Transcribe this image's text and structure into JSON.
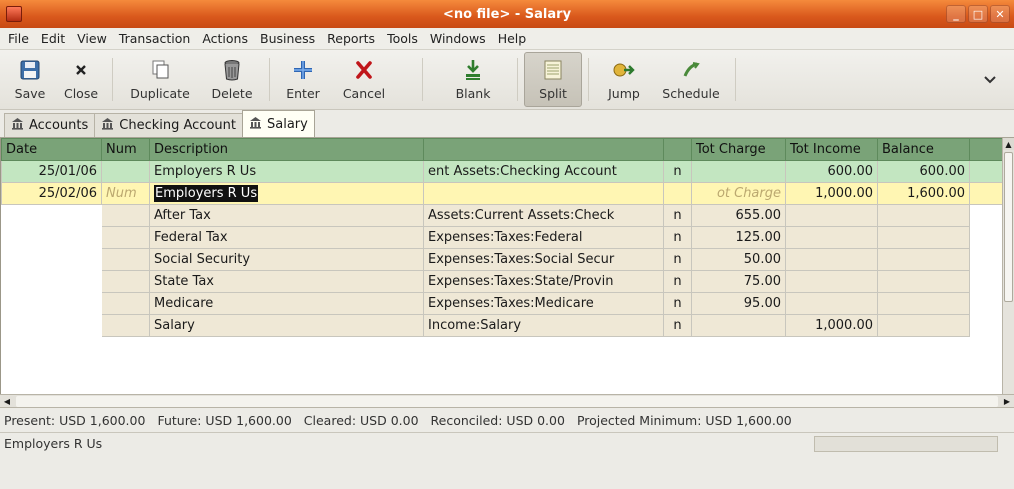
{
  "window": {
    "title": "<no file> - Salary"
  },
  "menu": [
    "File",
    "Edit",
    "View",
    "Transaction",
    "Actions",
    "Business",
    "Reports",
    "Tools",
    "Windows",
    "Help"
  ],
  "toolbar": {
    "save": "Save",
    "close": "Close",
    "duplicate": "Duplicate",
    "delete": "Delete",
    "enter": "Enter",
    "cancel": "Cancel",
    "blank": "Blank",
    "split": "Split",
    "jump": "Jump",
    "schedule": "Schedule"
  },
  "tabs": [
    {
      "label": "Accounts"
    },
    {
      "label": "Checking Account"
    },
    {
      "label": "Salary"
    }
  ],
  "register": {
    "headers": [
      "Date",
      "Num",
      "Description",
      "",
      "",
      "Tot Charge",
      "Tot Income",
      "Balance"
    ],
    "rows": [
      {
        "date": "25/01/06",
        "num": "",
        "description": "Employers R Us",
        "account": "ent Assets:Checking Account",
        "r": "n",
        "charge": "",
        "income": "600.00",
        "balance": "600.00"
      },
      {
        "date": "25/02/06",
        "num": "Num",
        "description": "Employers R Us",
        "account": "",
        "r": "",
        "charge": "ot Charge",
        "income": "1,000.00",
        "balance": "1,600.00"
      }
    ],
    "splits": [
      {
        "memo": "After Tax",
        "account": "Assets:Current Assets:Check",
        "r": "n",
        "charge": "655.00",
        "income": ""
      },
      {
        "memo": "Federal Tax",
        "account": "Expenses:Taxes:Federal",
        "r": "n",
        "charge": "125.00",
        "income": ""
      },
      {
        "memo": "Social Security",
        "account": "Expenses:Taxes:Social Secur",
        "r": "n",
        "charge": "50.00",
        "income": ""
      },
      {
        "memo": "State Tax",
        "account": "Expenses:Taxes:State/Provin",
        "r": "n",
        "charge": "75.00",
        "income": ""
      },
      {
        "memo": "Medicare",
        "account": "Expenses:Taxes:Medicare",
        "r": "n",
        "charge": "95.00",
        "income": ""
      },
      {
        "memo": "Salary",
        "account": "Income:Salary",
        "r": "n",
        "charge": "",
        "income": "1,000.00"
      }
    ]
  },
  "summary": {
    "present": "Present: USD 1,600.00",
    "future": "Future: USD 1,600.00",
    "cleared": "Cleared: USD 0.00",
    "reconciled": "Reconciled: USD 0.00",
    "projected": "Projected Minimum: USD 1,600.00"
  },
  "status": {
    "text": "Employers R Us"
  }
}
